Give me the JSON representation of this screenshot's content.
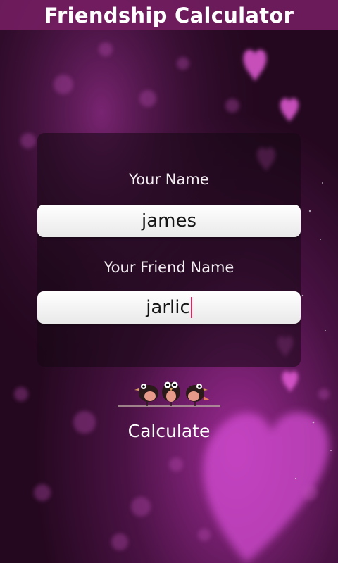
{
  "app": {
    "title": "Friendship Calculator"
  },
  "form": {
    "your_name_label": "Your Name",
    "your_name_value": "james",
    "friend_name_label": "Your Friend Name",
    "friend_name_value": "jarlic"
  },
  "actions": {
    "calculate_label": "Calculate"
  },
  "colors": {
    "accent": "#e0245e",
    "title_bar": "#781e64"
  },
  "icons": {
    "decoration": "birds-icon"
  }
}
